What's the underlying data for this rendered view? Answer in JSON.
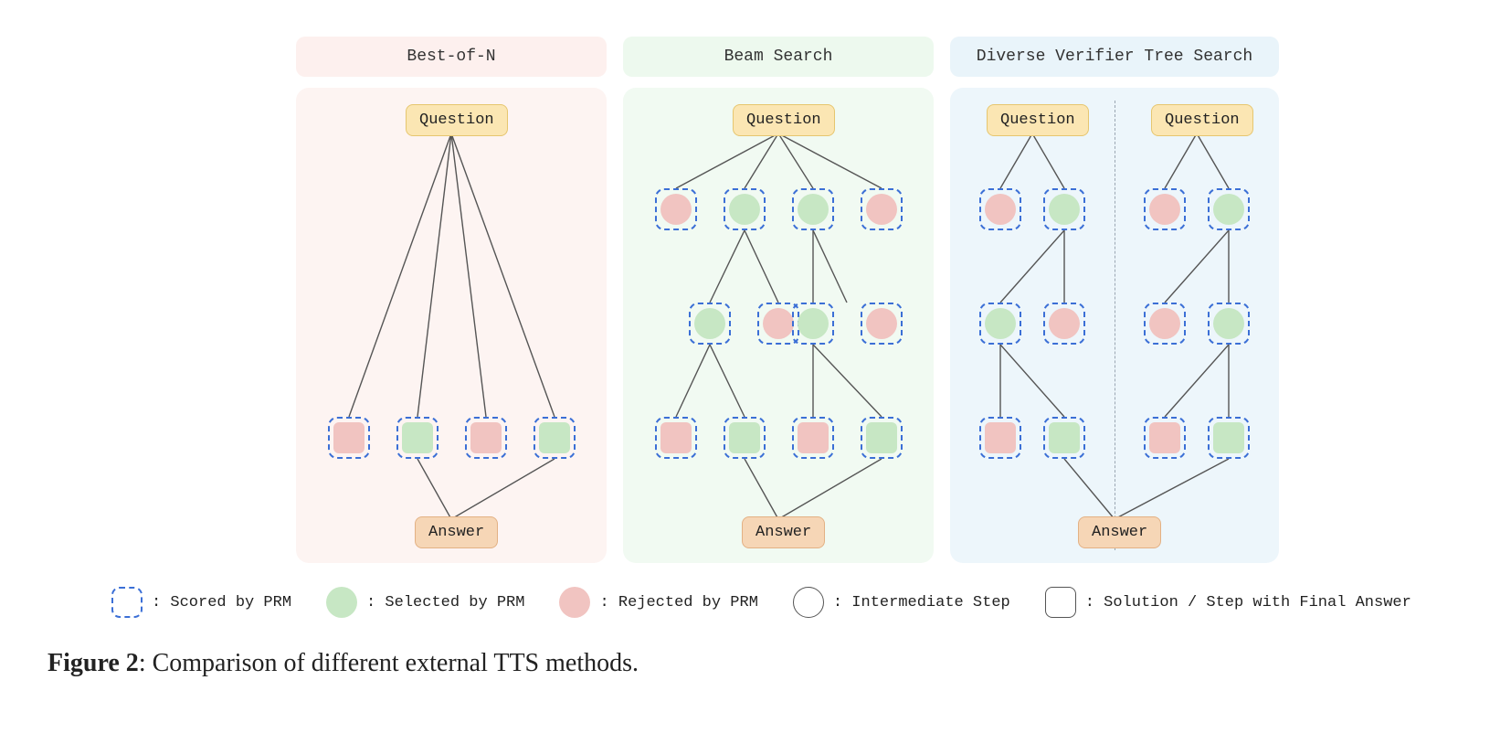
{
  "panels": {
    "bon": {
      "title": "Best-of-N",
      "question": "Question",
      "answer": "Answer"
    },
    "beam": {
      "title": "Beam Search",
      "question": "Question",
      "answer": "Answer"
    },
    "dvts": {
      "title": "Diverse Verifier Tree Search",
      "questionL": "Question",
      "questionR": "Question",
      "answer": "Answer"
    }
  },
  "legend": {
    "scored": ": Scored by PRM",
    "selected": ": Selected by PRM",
    "rejected": ": Rejected by PRM",
    "intermediate": ": Intermediate Step",
    "solution": ": Solution / Step with Final Answer"
  },
  "caption": {
    "label": "Figure 2",
    "text": ": Comparison of different external TTS methods."
  }
}
